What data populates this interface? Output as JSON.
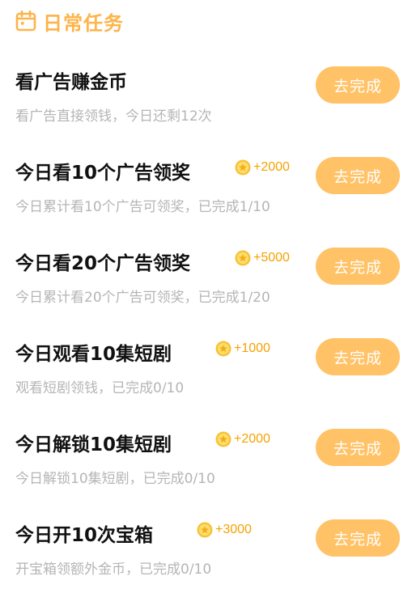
{
  "header": {
    "title": "日常任务",
    "icon": "calendar-icon",
    "accent_color": "#FDB44A"
  },
  "button_color": "#FFC266",
  "reward_color": "#F5A200",
  "tasks": [
    {
      "title": "看广告赚金币",
      "reward": "",
      "desc": "看广告直接领钱，今日还剩12次",
      "button": "去完成"
    },
    {
      "title": "今日看10个广告领奖",
      "reward": "+2000",
      "desc": "今日累计看10个广告可领奖，已完成1/10",
      "button": "去完成"
    },
    {
      "title": "今日看20个广告领奖",
      "reward": "+5000",
      "desc": "今日累计看20个广告可领奖，已完成1/20",
      "button": "去完成"
    },
    {
      "title": "今日观看10集短剧",
      "reward": "+1000",
      "desc": "观看短剧领钱，已完成0/10",
      "button": "去完成"
    },
    {
      "title": "今日解锁10集短剧",
      "reward": "+2000",
      "desc": "今日解锁10集短剧，已完成0/10",
      "button": "去完成"
    },
    {
      "title": "今日开10次宝箱",
      "reward": "+3000",
      "desc": "开宝箱领额外金币，已完成0/10",
      "button": "去完成"
    }
  ]
}
